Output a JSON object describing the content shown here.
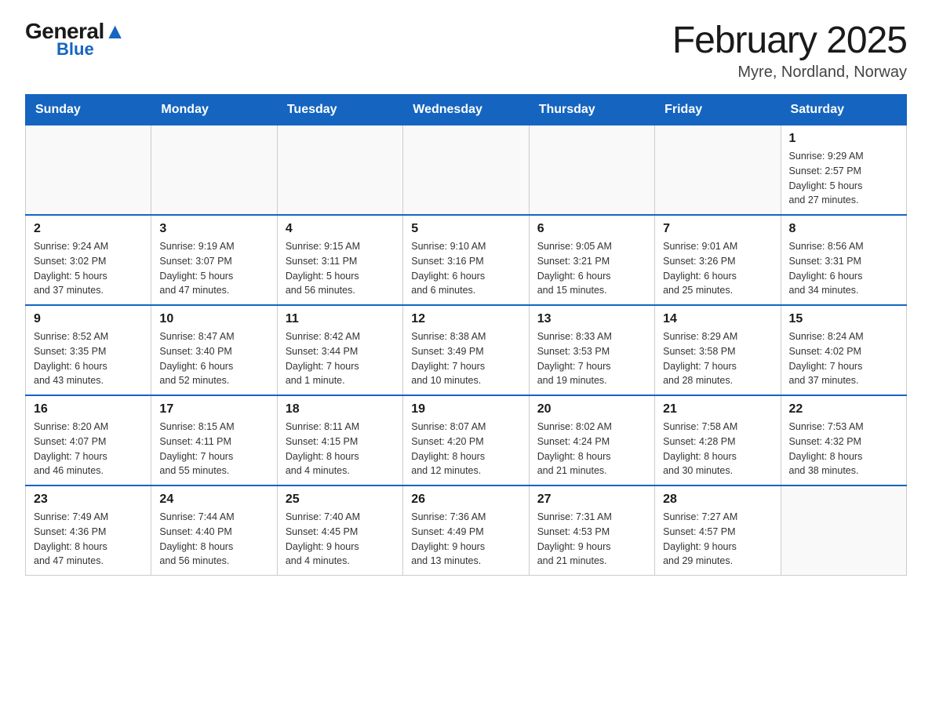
{
  "header": {
    "logo_general": "General",
    "logo_blue": "Blue",
    "title": "February 2025",
    "location": "Myre, Nordland, Norway"
  },
  "weekdays": [
    "Sunday",
    "Monday",
    "Tuesday",
    "Wednesday",
    "Thursday",
    "Friday",
    "Saturday"
  ],
  "weeks": [
    [
      {
        "day": "",
        "info": ""
      },
      {
        "day": "",
        "info": ""
      },
      {
        "day": "",
        "info": ""
      },
      {
        "day": "",
        "info": ""
      },
      {
        "day": "",
        "info": ""
      },
      {
        "day": "",
        "info": ""
      },
      {
        "day": "1",
        "info": "Sunrise: 9:29 AM\nSunset: 2:57 PM\nDaylight: 5 hours\nand 27 minutes."
      }
    ],
    [
      {
        "day": "2",
        "info": "Sunrise: 9:24 AM\nSunset: 3:02 PM\nDaylight: 5 hours\nand 37 minutes."
      },
      {
        "day": "3",
        "info": "Sunrise: 9:19 AM\nSunset: 3:07 PM\nDaylight: 5 hours\nand 47 minutes."
      },
      {
        "day": "4",
        "info": "Sunrise: 9:15 AM\nSunset: 3:11 PM\nDaylight: 5 hours\nand 56 minutes."
      },
      {
        "day": "5",
        "info": "Sunrise: 9:10 AM\nSunset: 3:16 PM\nDaylight: 6 hours\nand 6 minutes."
      },
      {
        "day": "6",
        "info": "Sunrise: 9:05 AM\nSunset: 3:21 PM\nDaylight: 6 hours\nand 15 minutes."
      },
      {
        "day": "7",
        "info": "Sunrise: 9:01 AM\nSunset: 3:26 PM\nDaylight: 6 hours\nand 25 minutes."
      },
      {
        "day": "8",
        "info": "Sunrise: 8:56 AM\nSunset: 3:31 PM\nDaylight: 6 hours\nand 34 minutes."
      }
    ],
    [
      {
        "day": "9",
        "info": "Sunrise: 8:52 AM\nSunset: 3:35 PM\nDaylight: 6 hours\nand 43 minutes."
      },
      {
        "day": "10",
        "info": "Sunrise: 8:47 AM\nSunset: 3:40 PM\nDaylight: 6 hours\nand 52 minutes."
      },
      {
        "day": "11",
        "info": "Sunrise: 8:42 AM\nSunset: 3:44 PM\nDaylight: 7 hours\nand 1 minute."
      },
      {
        "day": "12",
        "info": "Sunrise: 8:38 AM\nSunset: 3:49 PM\nDaylight: 7 hours\nand 10 minutes."
      },
      {
        "day": "13",
        "info": "Sunrise: 8:33 AM\nSunset: 3:53 PM\nDaylight: 7 hours\nand 19 minutes."
      },
      {
        "day": "14",
        "info": "Sunrise: 8:29 AM\nSunset: 3:58 PM\nDaylight: 7 hours\nand 28 minutes."
      },
      {
        "day": "15",
        "info": "Sunrise: 8:24 AM\nSunset: 4:02 PM\nDaylight: 7 hours\nand 37 minutes."
      }
    ],
    [
      {
        "day": "16",
        "info": "Sunrise: 8:20 AM\nSunset: 4:07 PM\nDaylight: 7 hours\nand 46 minutes."
      },
      {
        "day": "17",
        "info": "Sunrise: 8:15 AM\nSunset: 4:11 PM\nDaylight: 7 hours\nand 55 minutes."
      },
      {
        "day": "18",
        "info": "Sunrise: 8:11 AM\nSunset: 4:15 PM\nDaylight: 8 hours\nand 4 minutes."
      },
      {
        "day": "19",
        "info": "Sunrise: 8:07 AM\nSunset: 4:20 PM\nDaylight: 8 hours\nand 12 minutes."
      },
      {
        "day": "20",
        "info": "Sunrise: 8:02 AM\nSunset: 4:24 PM\nDaylight: 8 hours\nand 21 minutes."
      },
      {
        "day": "21",
        "info": "Sunrise: 7:58 AM\nSunset: 4:28 PM\nDaylight: 8 hours\nand 30 minutes."
      },
      {
        "day": "22",
        "info": "Sunrise: 7:53 AM\nSunset: 4:32 PM\nDaylight: 8 hours\nand 38 minutes."
      }
    ],
    [
      {
        "day": "23",
        "info": "Sunrise: 7:49 AM\nSunset: 4:36 PM\nDaylight: 8 hours\nand 47 minutes."
      },
      {
        "day": "24",
        "info": "Sunrise: 7:44 AM\nSunset: 4:40 PM\nDaylight: 8 hours\nand 56 minutes."
      },
      {
        "day": "25",
        "info": "Sunrise: 7:40 AM\nSunset: 4:45 PM\nDaylight: 9 hours\nand 4 minutes."
      },
      {
        "day": "26",
        "info": "Sunrise: 7:36 AM\nSunset: 4:49 PM\nDaylight: 9 hours\nand 13 minutes."
      },
      {
        "day": "27",
        "info": "Sunrise: 7:31 AM\nSunset: 4:53 PM\nDaylight: 9 hours\nand 21 minutes."
      },
      {
        "day": "28",
        "info": "Sunrise: 7:27 AM\nSunset: 4:57 PM\nDaylight: 9 hours\nand 29 minutes."
      },
      {
        "day": "",
        "info": ""
      }
    ]
  ]
}
